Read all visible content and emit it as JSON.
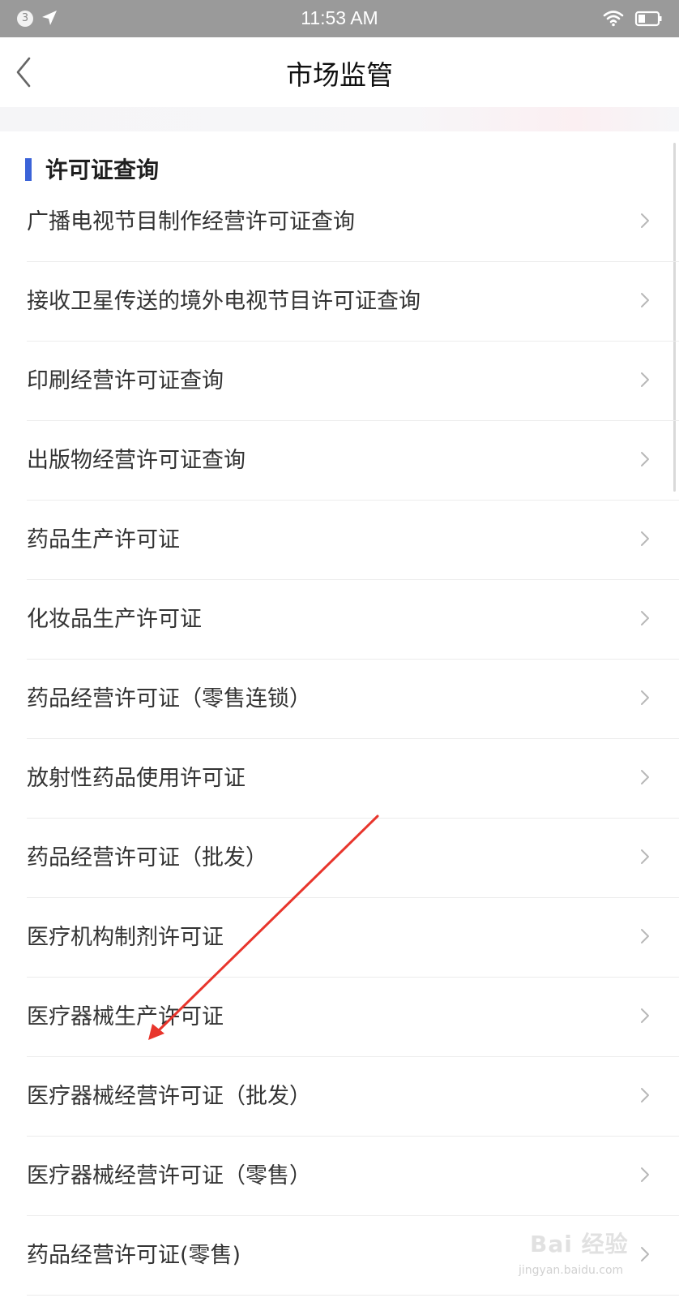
{
  "status_bar": {
    "badge": "3",
    "time": "11:53 AM",
    "icons": [
      "location-arrow-icon",
      "wifi-icon",
      "battery-icon"
    ]
  },
  "nav": {
    "title": "市场监管",
    "back_icon": "chevron-left-icon"
  },
  "section": {
    "title": "许可证查询",
    "accent_color": "#3b63d8"
  },
  "items": [
    {
      "label": "广播电视节目制作经营许可证查询"
    },
    {
      "label": "接收卫星传送的境外电视节目许可证查询"
    },
    {
      "label": "印刷经营许可证查询"
    },
    {
      "label": "出版物经营许可证查询"
    },
    {
      "label": "药品生产许可证"
    },
    {
      "label": "化妆品生产许可证"
    },
    {
      "label": "药品经营许可证（零售连锁）"
    },
    {
      "label": "放射性药品使用许可证"
    },
    {
      "label": "药品经营许可证（批发）"
    },
    {
      "label": "医疗机构制剂许可证"
    },
    {
      "label": "医疗器械生产许可证"
    },
    {
      "label": "医疗器械经营许可证（批发）"
    },
    {
      "label": "医疗器械经营许可证（零售）"
    },
    {
      "label": "药品经营许可证(零售)"
    }
  ],
  "annotation": {
    "color": "#e8352c",
    "points_to_item": "医疗器械经营许可证（批发）"
  },
  "watermark": {
    "text": "Bai 经验",
    "sub": "jingyan.baidu.com"
  }
}
